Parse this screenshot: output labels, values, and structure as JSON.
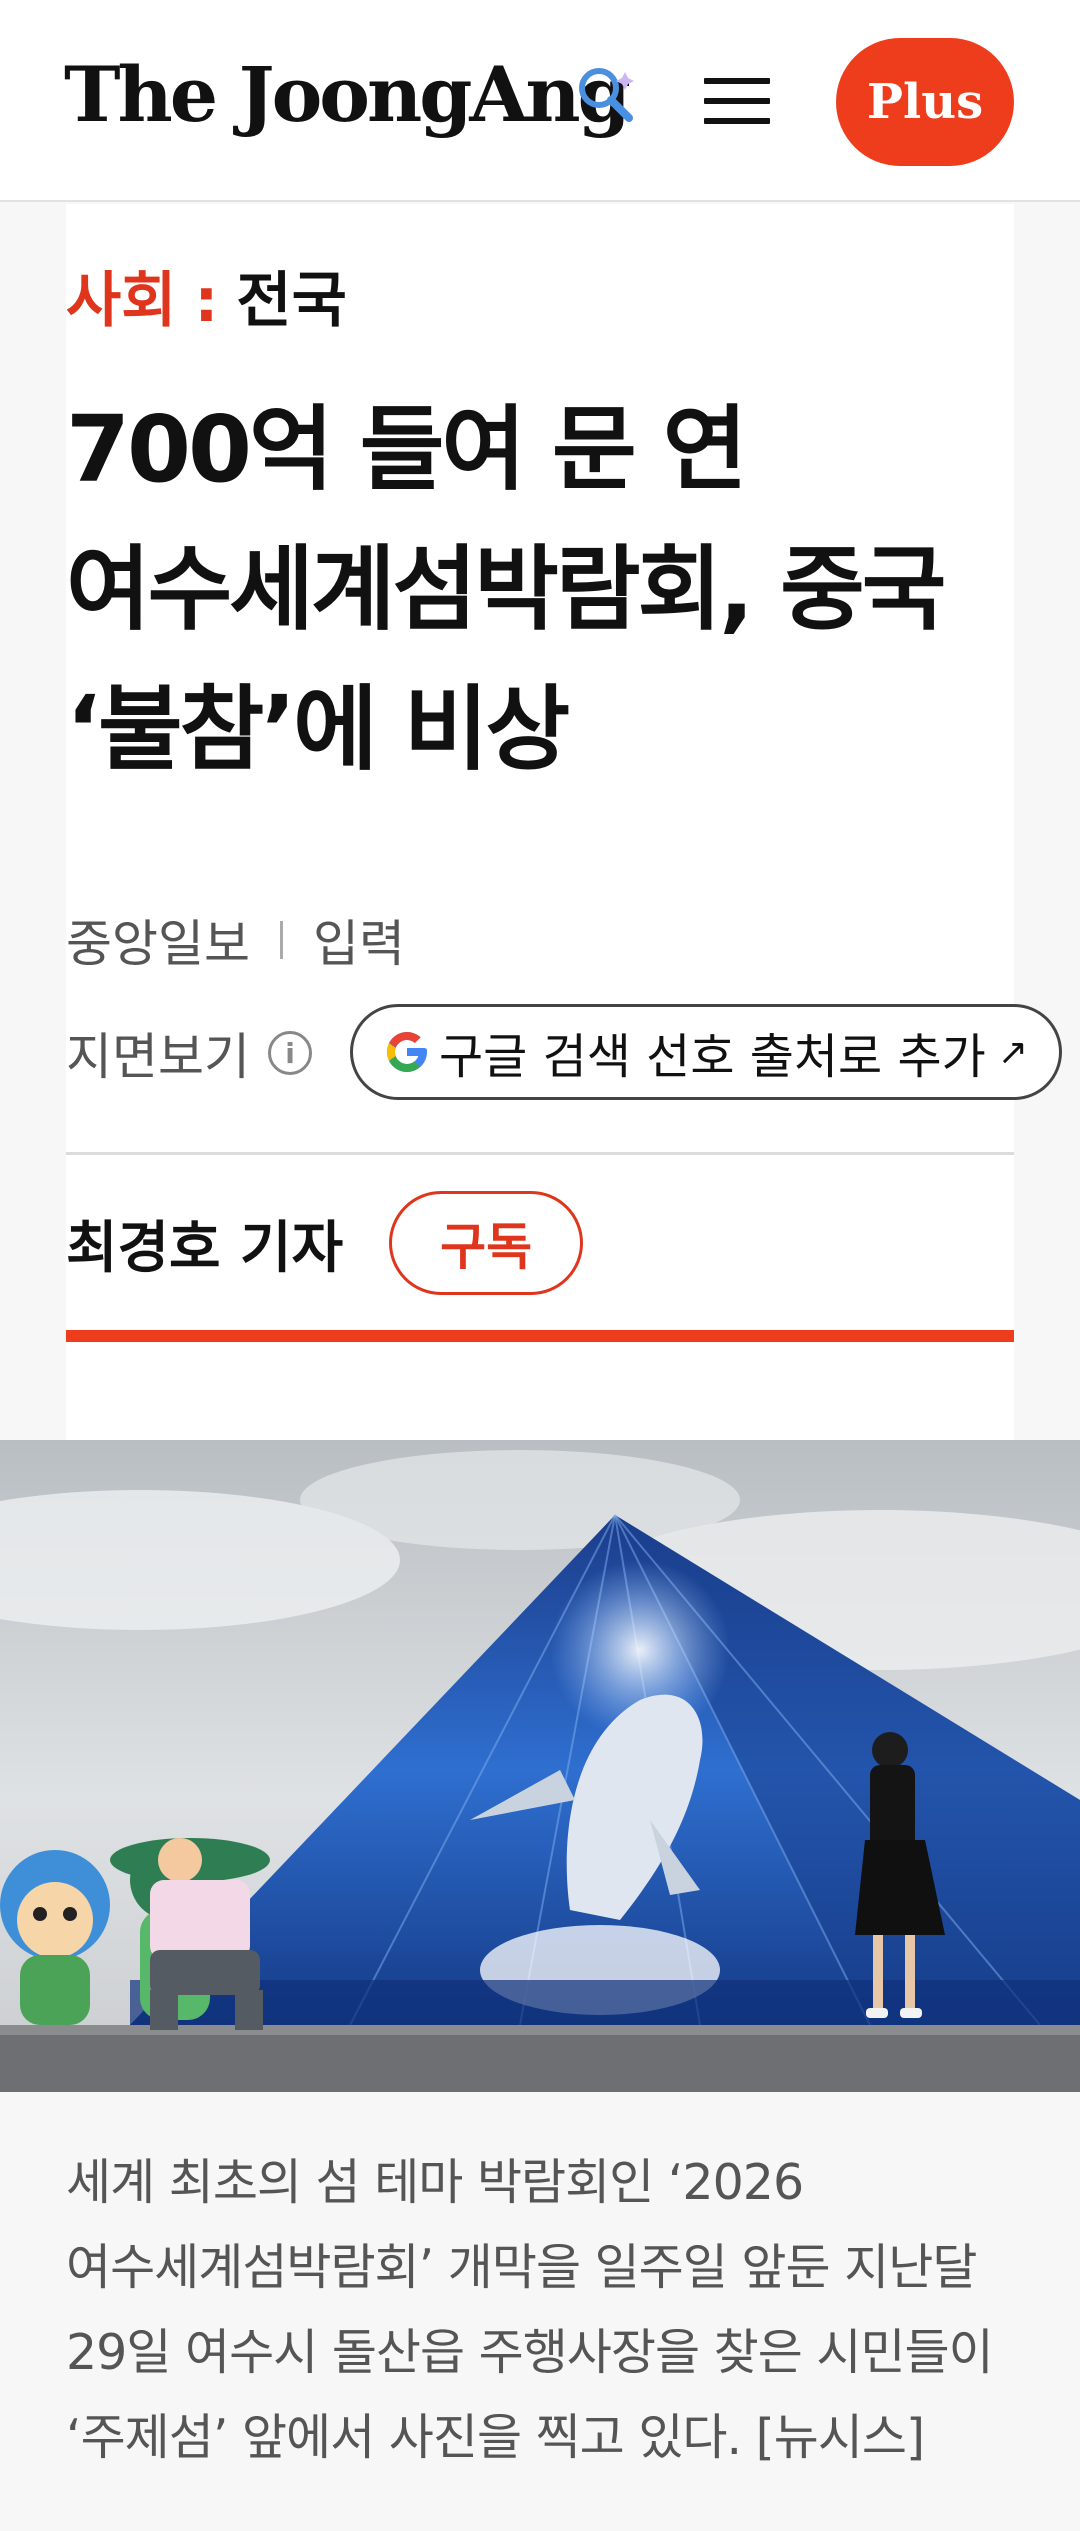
{
  "header": {
    "logo_text": "The JoongAng",
    "plus_label": "Plus",
    "icons": [
      "search-icon",
      "menu-icon"
    ],
    "accent_color": "#ee3d1c"
  },
  "article": {
    "section": "사회",
    "separator": ":",
    "subsection": "전국",
    "headline_lines": [
      "700억 들여 문 연",
      "여수세계섬박람회, 중국",
      "‘불참’에 비상"
    ],
    "source": "중앙일보",
    "input_label": "입력",
    "print_label": "지면보기",
    "google_button_label": "구글 검색 선호 출처로 추가",
    "author": "최경호 기자",
    "subscribe_label": "구독"
  },
  "photo": {
    "caption_lines": [
      "세계 최초의 섬 테마 박람회인 ‘2026",
      "여수세계섬박람회’ 개막을 일주일 앞둔 지난달",
      "29일 여수시 돌산읍 주행사장을 찾은 시민들이",
      "‘주제섬’ 앞에서 사진을 찍고 있다. [뉴시스]"
    ]
  }
}
